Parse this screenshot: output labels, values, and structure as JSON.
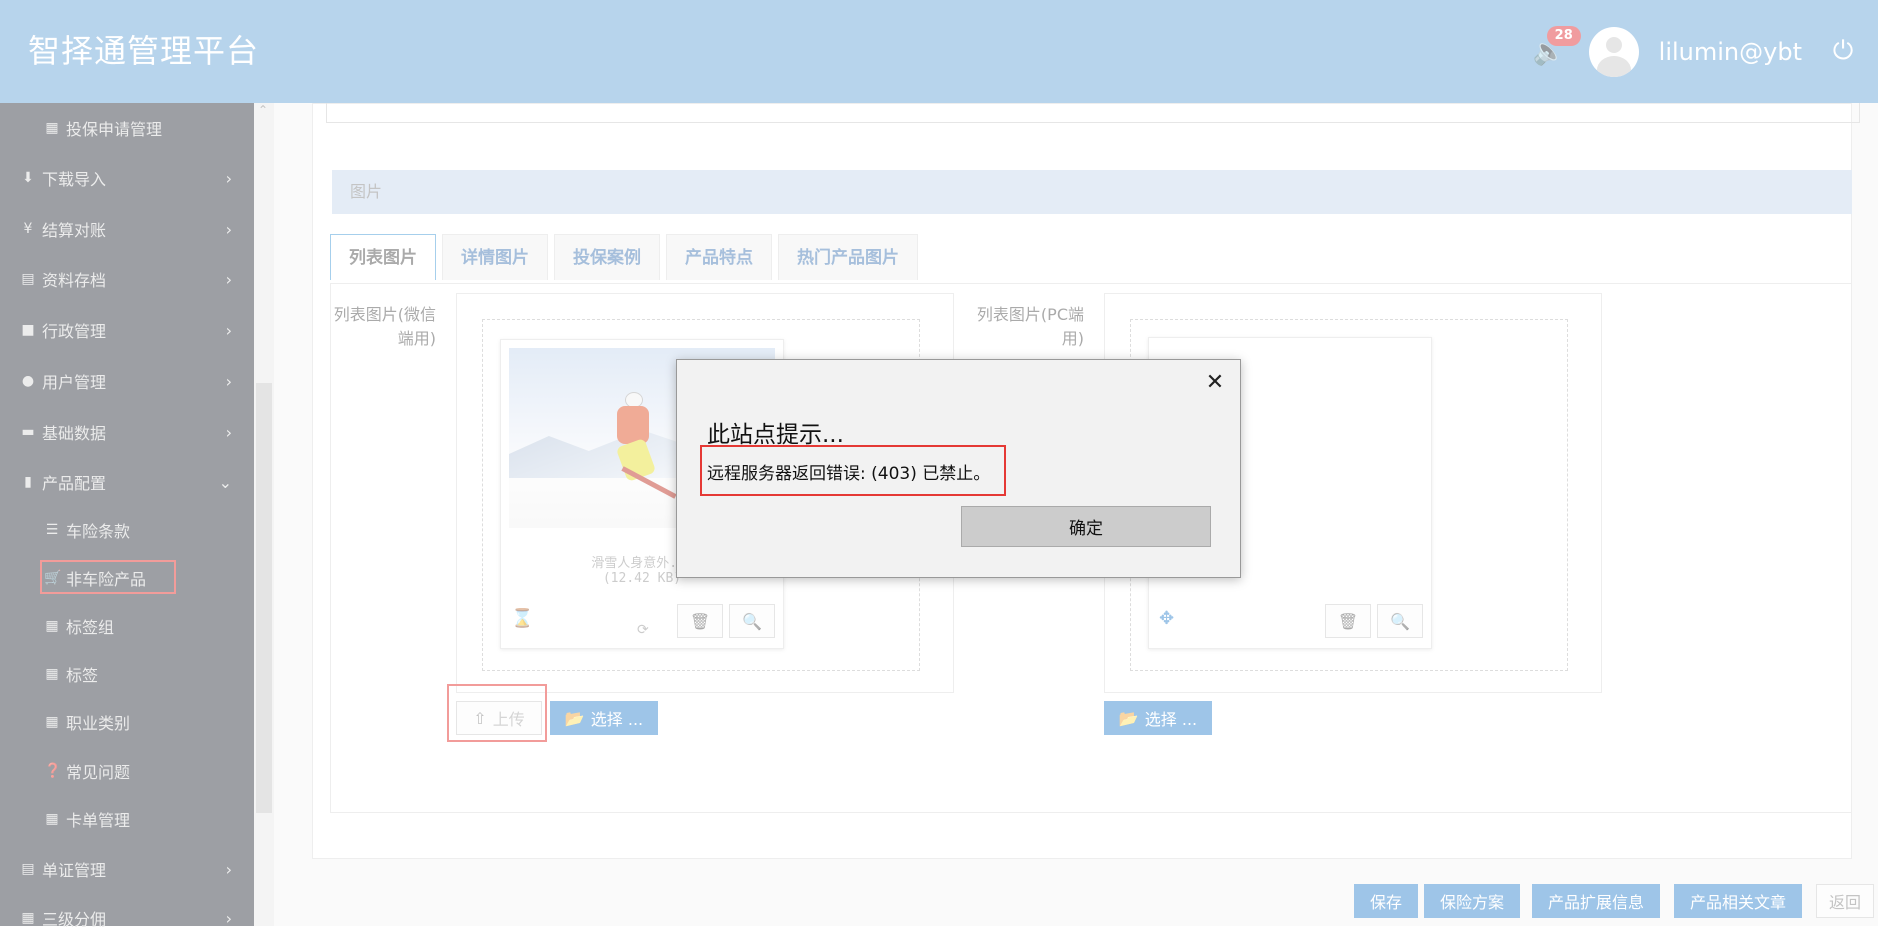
{
  "header": {
    "brand": "智择通管理平台",
    "notification_count": "28",
    "username": "lilumin@ybt"
  },
  "sidebar": {
    "items": [
      {
        "label": "投保申请管理",
        "icon": "grid-icon",
        "sub": true
      },
      {
        "label": "下载导入",
        "icon": "download-icon",
        "chevron": "›"
      },
      {
        "label": "结算对账",
        "icon": "yen-icon",
        "chevron": "›"
      },
      {
        "label": "资料存档",
        "icon": "archive-icon",
        "chevron": "›"
      },
      {
        "label": "行政管理",
        "icon": "folder-icon",
        "chevron": "›"
      },
      {
        "label": "用户管理",
        "icon": "user-icon",
        "chevron": "›"
      },
      {
        "label": "基础数据",
        "icon": "hdd-icon",
        "chevron": "›"
      },
      {
        "label": "产品配置",
        "icon": "book-icon",
        "chevron": "⌄"
      },
      {
        "label": "车险条款",
        "icon": "list-icon",
        "sub": true
      },
      {
        "label": "非车险产品",
        "icon": "cart-icon",
        "sub": true
      },
      {
        "label": "标签组",
        "icon": "grid-icon",
        "sub": true
      },
      {
        "label": "标签",
        "icon": "grid-icon",
        "sub": true
      },
      {
        "label": "职业类别",
        "icon": "grid-icon",
        "sub": true
      },
      {
        "label": "常见问题",
        "icon": "question-icon",
        "sub": true
      },
      {
        "label": "卡单管理",
        "icon": "grid-icon",
        "sub": true
      },
      {
        "label": "单证管理",
        "icon": "doc-icon",
        "chevron": "›"
      },
      {
        "label": "三级分佣",
        "icon": "grid-icon",
        "chevron": "›"
      }
    ]
  },
  "main": {
    "section_title": "图片",
    "tabs": [
      "列表图片",
      "详情图片",
      "投保案例",
      "产品特点",
      "热门产品图片"
    ],
    "left_label_line1": "列表图片(微信",
    "left_label_line2": "端用)",
    "right_label_line1": "列表图片(PC端",
    "right_label_line2": "用)",
    "file_caption_line1": "滑雪人身意外...",
    "file_caption_line2": "(12.42 KB)",
    "upload_label": "上传",
    "select_label_left": "选择 ...",
    "select_label_right": "选择 ..."
  },
  "footer_buttons": [
    "保存",
    "保险方案",
    "产品扩展信息",
    "产品相关文章",
    "返回"
  ],
  "dialog": {
    "title": "此站点提示...",
    "message": "远程服务器返回错误: (403) 已禁止。",
    "ok_label": "确定",
    "close_symbol": "✕"
  }
}
